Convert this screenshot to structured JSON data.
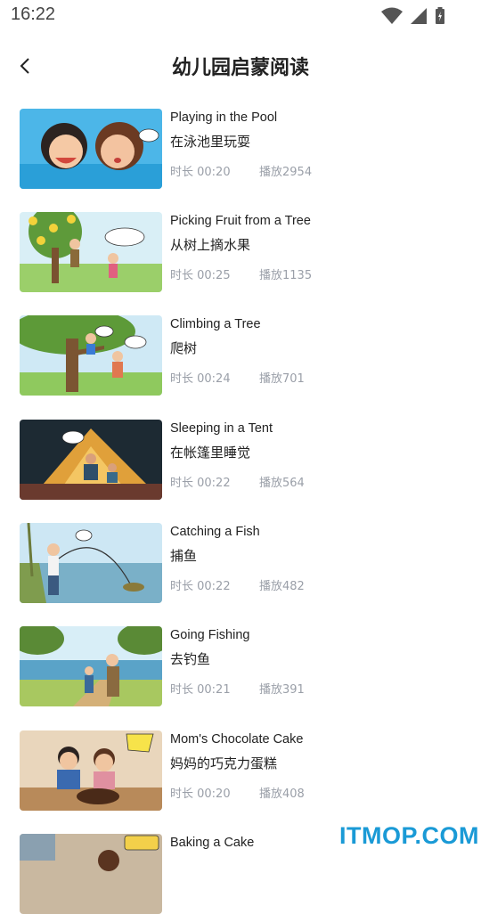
{
  "status": {
    "time": "16:22"
  },
  "header": {
    "title": "幼儿园启蒙阅读"
  },
  "items": [
    {
      "en": "Playing in the Pool",
      "zh": "在泳池里玩耍",
      "duration": "时长 00:20",
      "plays": "播放2954"
    },
    {
      "en": "Picking Fruit from a Tree",
      "zh": "从树上摘水果",
      "duration": "时长 00:25",
      "plays": "播放1135"
    },
    {
      "en": "Climbing a Tree",
      "zh": "爬树",
      "duration": "时长 00:24",
      "plays": "播放701"
    },
    {
      "en": "Sleeping in a Tent",
      "zh": "在帐篷里睡觉",
      "duration": "时长 00:22",
      "plays": "播放564"
    },
    {
      "en": "Catching a Fish",
      "zh": "捕鱼",
      "duration": "时长 00:22",
      "plays": "播放482"
    },
    {
      "en": "Going Fishing",
      "zh": "去钓鱼",
      "duration": "时长 00:21",
      "plays": "播放391"
    },
    {
      "en": "Mom's Chocolate Cake",
      "zh": "妈妈的巧克力蛋糕",
      "duration": "时长 00:20",
      "plays": "播放408"
    },
    {
      "en": "Baking a Cake",
      "zh": "",
      "duration": "",
      "plays": ""
    }
  ],
  "watermark": "ITMOP.COM"
}
